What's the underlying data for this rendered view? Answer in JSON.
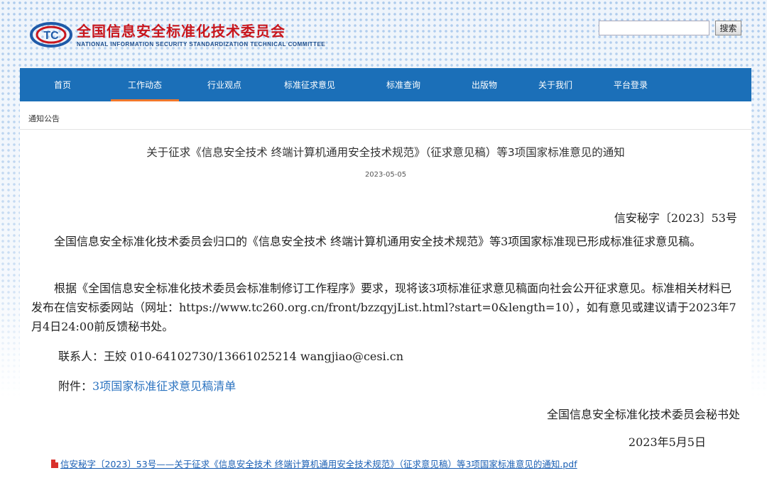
{
  "header": {
    "logo_cn": "全国信息安全标准化技术委员会",
    "logo_en": "NATIONAL INFORMATION SECURITY STANDARDIZATION TECHNICAL COMMITTEE",
    "logo_mark": "TC",
    "search_placeholder": "",
    "search_button": "搜索"
  },
  "nav": {
    "items": [
      {
        "label": "首页"
      },
      {
        "label": "工作动态"
      },
      {
        "label": "行业观点"
      },
      {
        "label": "标准征求意见"
      },
      {
        "label": "标准查询"
      },
      {
        "label": "出版物"
      },
      {
        "label": "关于我们"
      },
      {
        "label": "平台登录"
      }
    ],
    "active_index": 1
  },
  "breadcrumb": "通知公告",
  "article": {
    "title": "关于征求《信息安全技术 终端计算机通用安全技术规范》（征求意见稿）等3项国家标准意见的通知",
    "date": "2023-05-05",
    "doc_no": "信安秘字〔2023〕53号",
    "para1": "全国信息安全标准化技术委员会归口的《信息安全技术 终端计算机通用安全技术规范》等3项国家标准现已形成标准征求意见稿。",
    "para2": "根据《全国信息安全标准化技术委员会标准制修订工作程序》要求，现将该3项标准征求意见稿面向社会公开征求意见。标准相关材料已发布在信安标委网站（网址：https://www.tc260.org.cn/front/bzzqyjList.html?start=0&length=10），如有意见或建议请于2023年7月4日24:00前反馈秘书处。",
    "contact": "联系人：王姣  010-64102730/13661025214  wangjiao@cesi.cn",
    "attach_prefix": "附件：",
    "attach_link": "3项国家标准征求意见稿清单",
    "sign_org": "全国信息安全标准化技术委员会秘书处",
    "sign_date": "2023年5月5日",
    "pdf_link": "信安秘字〔2023〕53号——关于征求《信息安全技术 终端计算机通用安全技术规范》（征求意见稿）等3项国家标准意见的通知.pdf"
  },
  "colors": {
    "nav_bg": "#1b6fb8",
    "nav_active_underline": "#f0782c",
    "logo_red": "#c8161d",
    "link_blue": "#2b73c0"
  }
}
